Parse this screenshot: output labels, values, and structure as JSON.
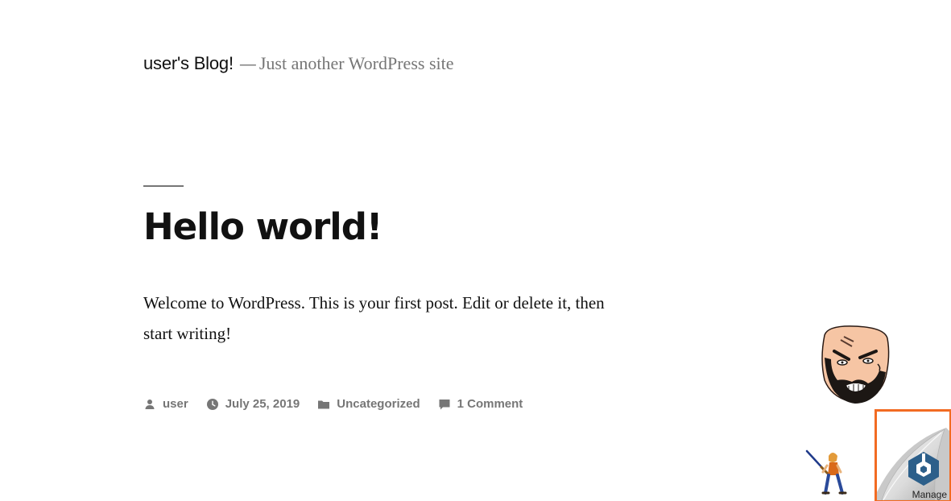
{
  "site": {
    "title": "user's Blog!",
    "separator": "—",
    "description": "Just another WordPress site"
  },
  "post": {
    "title": "Hello world!",
    "content": "Welcome to WordPress. This is your first post. Edit or delete it, then start writing!"
  },
  "meta": {
    "author": {
      "icon": "person-icon",
      "label": "user"
    },
    "date": {
      "icon": "clock-icon",
      "label": "July 25, 2019"
    },
    "category": {
      "icon": "folder-icon",
      "label": "Uncategorized"
    },
    "comments": {
      "icon": "comment-icon",
      "label": "1 Comment"
    }
  },
  "widget": {
    "label": "Manage",
    "icon": "hexagon-logo-icon",
    "border_color": "#f26b22",
    "logo_color": "#2c5f8a"
  },
  "colors": {
    "text": "#111111",
    "muted": "#767676",
    "background": "#ffffff"
  }
}
